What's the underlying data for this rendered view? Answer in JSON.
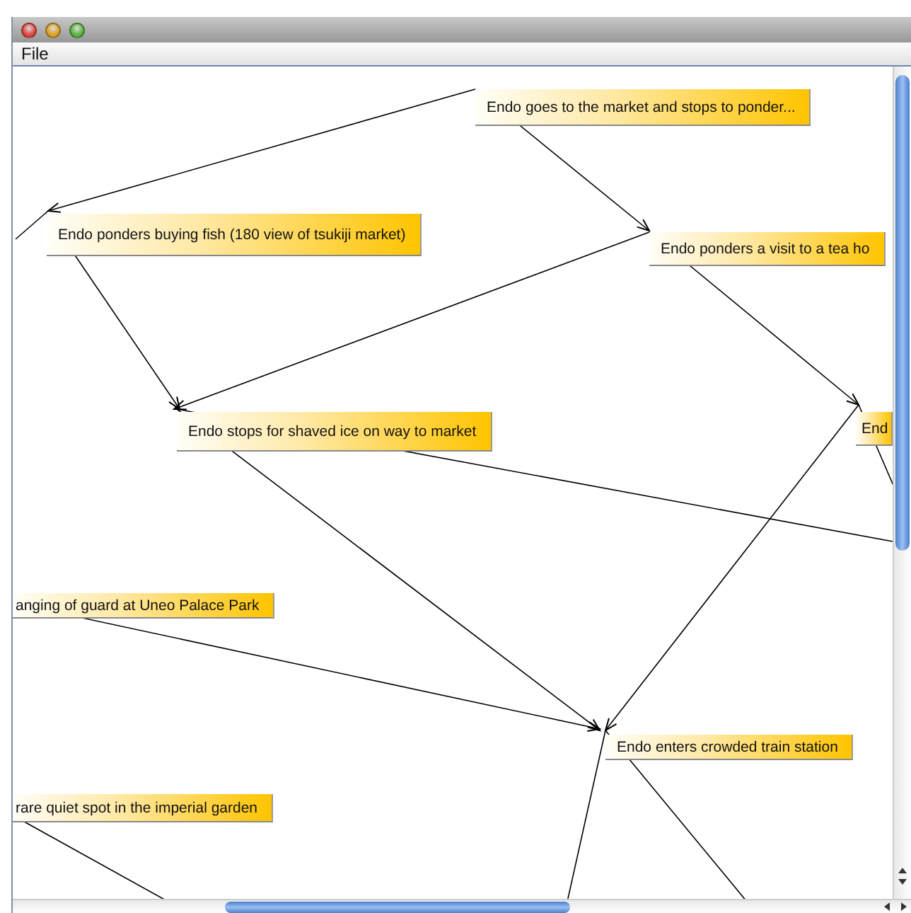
{
  "menu": [
    "File"
  ],
  "nodes": [
    {
      "label": "Endo goes to the market and stops to ponder..."
    },
    {
      "label": "Endo ponders buying fish (180 view of tsukiji market)"
    },
    {
      "label": "Endo ponders a visit to a tea ho"
    },
    {
      "label": "Endo stops for shaved ice on way to market"
    },
    {
      "label": "End"
    },
    {
      "label": "anging of guard at Uneo Palace Park"
    },
    {
      "label": "Endo enters crowded train station"
    },
    {
      "label": "rare quiet spot in the imperial garden"
    }
  ]
}
